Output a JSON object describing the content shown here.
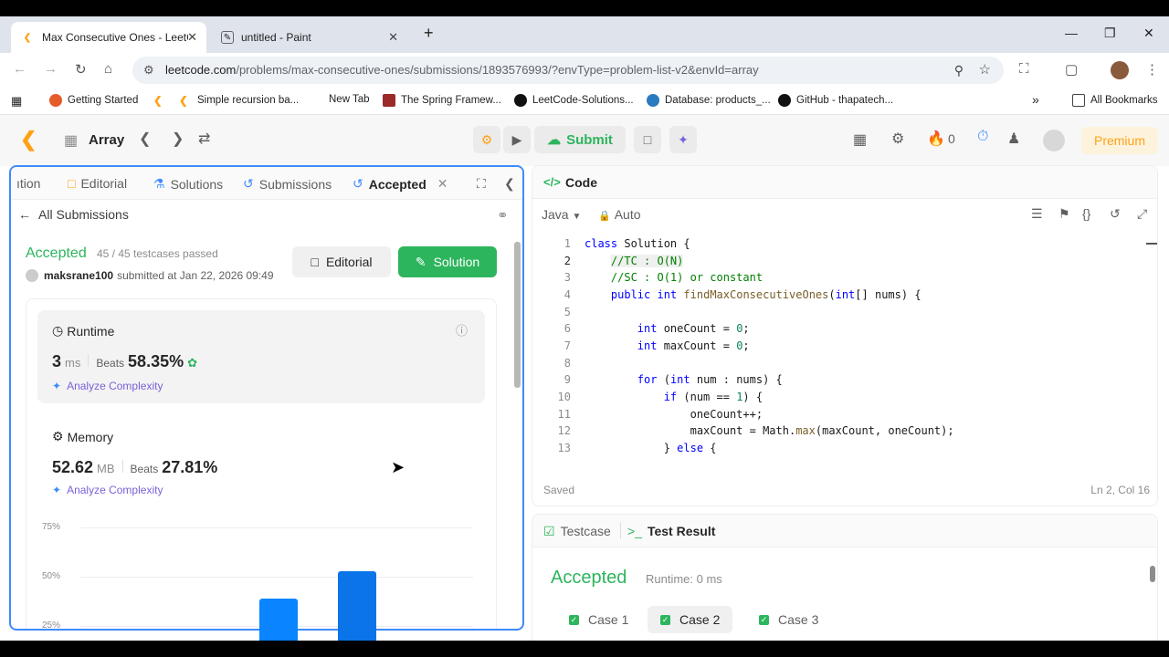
{
  "browser": {
    "tabs": [
      {
        "title": "Max Consecutive Ones - LeetCo",
        "icon": "leetcode-icon"
      },
      {
        "title": "untitled - Paint",
        "icon": "paint-icon"
      }
    ],
    "new_tab": "+",
    "url_domain": "leetcode.com",
    "url_path": "/problems/max-consecutive-ones/submissions/1893576993/?envType=problem-list-v2&envId=array",
    "bookmarks": [
      "Getting Started",
      "Simple recursion ba...",
      "New Tab",
      "The Spring Framew...",
      "LeetCode-Solutions...",
      "Database: products_...",
      "GitHub - thapatech..."
    ],
    "more_bookmarks": "»",
    "all_bookmarks": "All Bookmarks"
  },
  "topbar": {
    "problem_list": "Array",
    "submit": "Submit",
    "streak": "0",
    "premium": "Premium"
  },
  "left": {
    "tabs": {
      "cut": "ıtion",
      "editorial": "Editorial",
      "solutions": "Solutions",
      "submissions": "Submissions",
      "accepted": "Accepted"
    },
    "all_submissions": "All Submissions",
    "status": "Accepted",
    "testcases": "45 / 45 testcases passed",
    "username": "maksrane100",
    "submitted_at": "submitted at Jan 22, 2026 09:49",
    "editorial_btn": "Editorial",
    "solution_btn": "Solution",
    "runtime": {
      "title": "Runtime",
      "value": "3",
      "unit": "ms",
      "beats_label": "Beats",
      "beats": "58.35%",
      "analyze": "Analyze Complexity"
    },
    "memory": {
      "title": "Memory",
      "value": "52.62",
      "unit": "MB",
      "beats_label": "Beats",
      "beats": "27.81%",
      "analyze": "Analyze Complexity"
    },
    "chart_data": {
      "type": "bar",
      "ylabels": [
        "75%",
        "50%",
        "25%"
      ],
      "values": [
        39,
        53
      ],
      "ylim": [
        25,
        75
      ]
    }
  },
  "code": {
    "title": "Code",
    "language": "Java",
    "mode": "Auto",
    "lines": [
      "1",
      "2",
      "3",
      "4",
      "5",
      "6",
      "7",
      "8",
      "9",
      "10",
      "11",
      "12",
      "13"
    ],
    "saved": "Saved",
    "cursor_pos": "Ln 2, Col 16"
  },
  "tests": {
    "testcase_tab": "Testcase",
    "result_tab": "Test Result",
    "status": "Accepted",
    "runtime": "Runtime: 0 ms",
    "cases": [
      "Case 1",
      "Case 2",
      "Case 3"
    ]
  }
}
